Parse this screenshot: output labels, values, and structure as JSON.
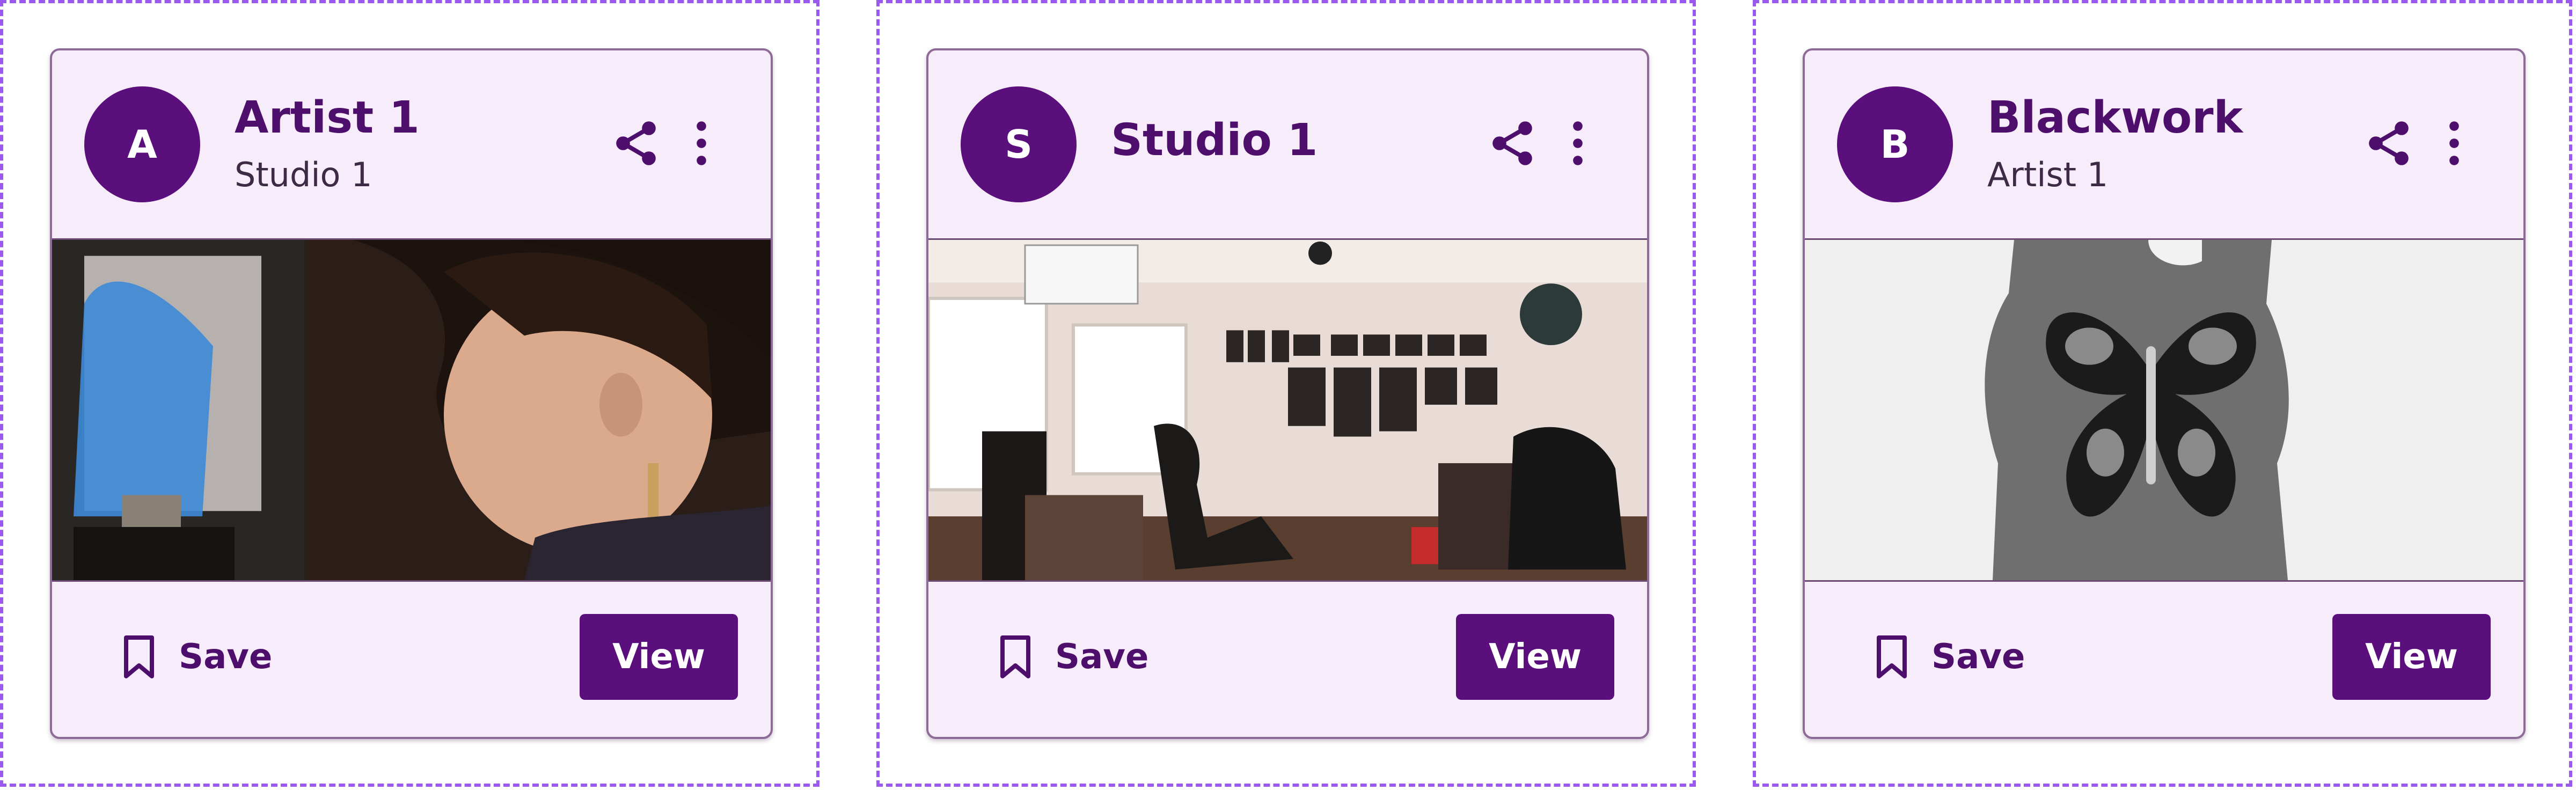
{
  "cards": [
    {
      "avatar_initial": "A",
      "title": "Artist 1",
      "subtitle": "Studio 1",
      "save_label": "Save",
      "view_label": "View",
      "image_alt": "Tattoo artist working"
    },
    {
      "avatar_initial": "S",
      "title": "Studio 1",
      "subtitle": "",
      "save_label": "Save",
      "view_label": "View",
      "image_alt": "Tattoo studio interior"
    },
    {
      "avatar_initial": "B",
      "title": "Blackwork",
      "subtitle": "Artist 1",
      "save_label": "Save",
      "view_label": "View",
      "image_alt": "Butterfly blackwork tattoo on hand"
    }
  ],
  "colors": {
    "accent": "#5a0f7d",
    "card_background": "#f7ecfa",
    "dashed_border": "#9b59f0"
  },
  "icons": [
    "share-icon",
    "more-vertical-icon",
    "bookmark-icon"
  ]
}
